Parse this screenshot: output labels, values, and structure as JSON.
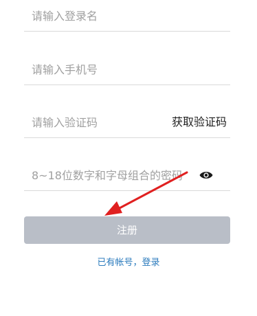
{
  "form": {
    "username_placeholder": "请输入登录名",
    "phone_placeholder": "请输入手机号",
    "code_placeholder": "请输入验证码",
    "get_code_label": "获取验证码",
    "password_placeholder": "8~18位数字和字母组合的密码",
    "password_toggle_icon": "eye-icon",
    "register_label": "注册",
    "login_link_label": "已有帐号，登录"
  },
  "colors": {
    "button_bg": "#b9bec7",
    "link": "#2b7bbd",
    "annotation_arrow": "#e02020"
  }
}
